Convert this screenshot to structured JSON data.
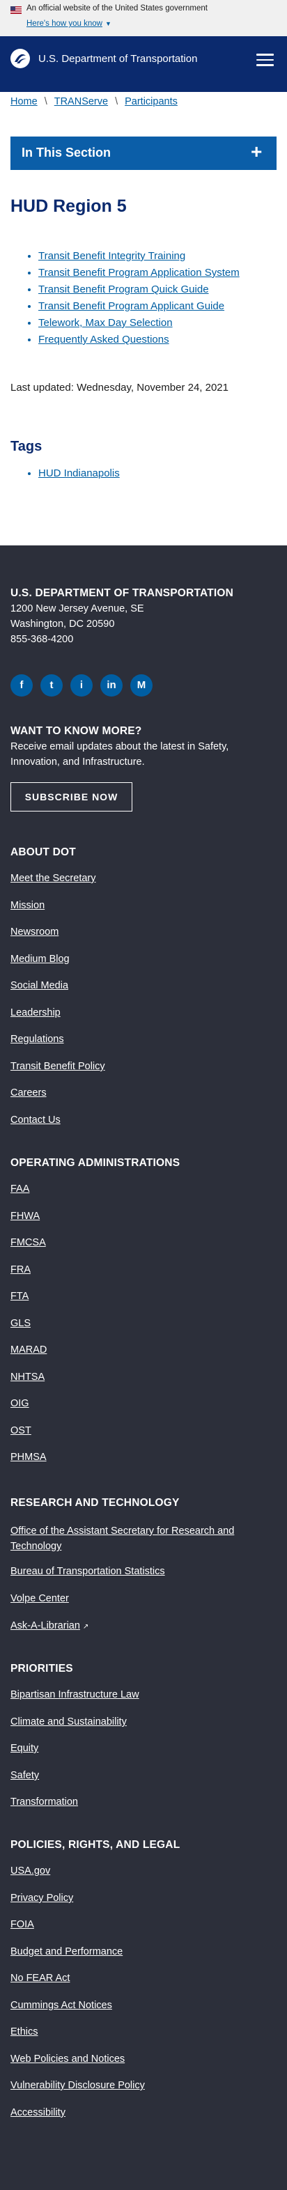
{
  "gov_banner": {
    "text": "An official website of the United States government",
    "link": "Here's how you know"
  },
  "header": {
    "title": "U.S. Department of Transportation",
    "logo_icon": "dot-logo-icon",
    "menu_icon": "hamburger-menu-icon"
  },
  "breadcrumb": [
    "Home",
    "TRANServe",
    "Participants"
  ],
  "section_nav": {
    "label": "In This Section",
    "toggle": "+"
  },
  "page_title": "HUD Region 5",
  "links": [
    "Transit Benefit Integrity Training",
    "Transit Benefit Program Application System",
    "Transit Benefit Program Quick Guide",
    "Transit Benefit Program Applicant Guide",
    "Telework, Max Day Selection",
    "Frequently Asked Questions"
  ],
  "last_updated": "Last updated: Wednesday, November 24, 2021",
  "tags": {
    "heading": "Tags",
    "items": [
      "HUD Indianapolis"
    ]
  },
  "footer": {
    "org_name": "U.S. DEPARTMENT OF TRANSPORTATION",
    "address1": "1200 New Jersey Avenue, SE",
    "address2": "Washington, DC 20590",
    "phone": "855-368-4200",
    "social": [
      "f",
      "t",
      "i",
      "in",
      "M"
    ],
    "want_heading": "WANT TO KNOW MORE?",
    "want_text": "Receive email updates about the latest in Safety, Innovation, and Infrastructure.",
    "subscribe_label": "SUBSCRIBE NOW",
    "about": {
      "heading": "ABOUT DOT",
      "items": [
        "Meet the Secretary",
        "Mission",
        "Newsroom",
        "Medium Blog",
        "Social Media",
        "Leadership",
        "Regulations",
        "Transit Benefit Policy",
        "Careers",
        "Contact Us"
      ]
    },
    "operating": {
      "heading": "OPERATING ADMINISTRATIONS",
      "items": [
        "FAA",
        "FHWA",
        "FMCSA",
        "FRA",
        "FTA",
        "GLS",
        "MARAD",
        "NHTSA",
        "OIG",
        "OST",
        "PHMSA"
      ]
    },
    "research": {
      "heading": "RESEARCH AND TECHNOLOGY",
      "items": [
        "Office of the Assistant Secretary for Research and Technology",
        "Bureau of Transportation Statistics",
        "Volpe Center",
        "Ask-A-Librarian"
      ]
    },
    "priorities": {
      "heading": "PRIORITIES",
      "items": [
        "Bipartisan Infrastructure Law",
        "Climate and Sustainability",
        "Equity",
        "Safety",
        "Transformation"
      ]
    },
    "policies": {
      "heading": "POLICIES, RIGHTS, AND LEGAL",
      "items": [
        "USA.gov",
        "Privacy Policy",
        "FOIA",
        "Budget and Performance",
        "No FEAR Act",
        "Cummings Act Notices",
        "Ethics",
        "Web Policies and Notices",
        "Vulnerability Disclosure Policy",
        "Accessibility"
      ]
    }
  }
}
